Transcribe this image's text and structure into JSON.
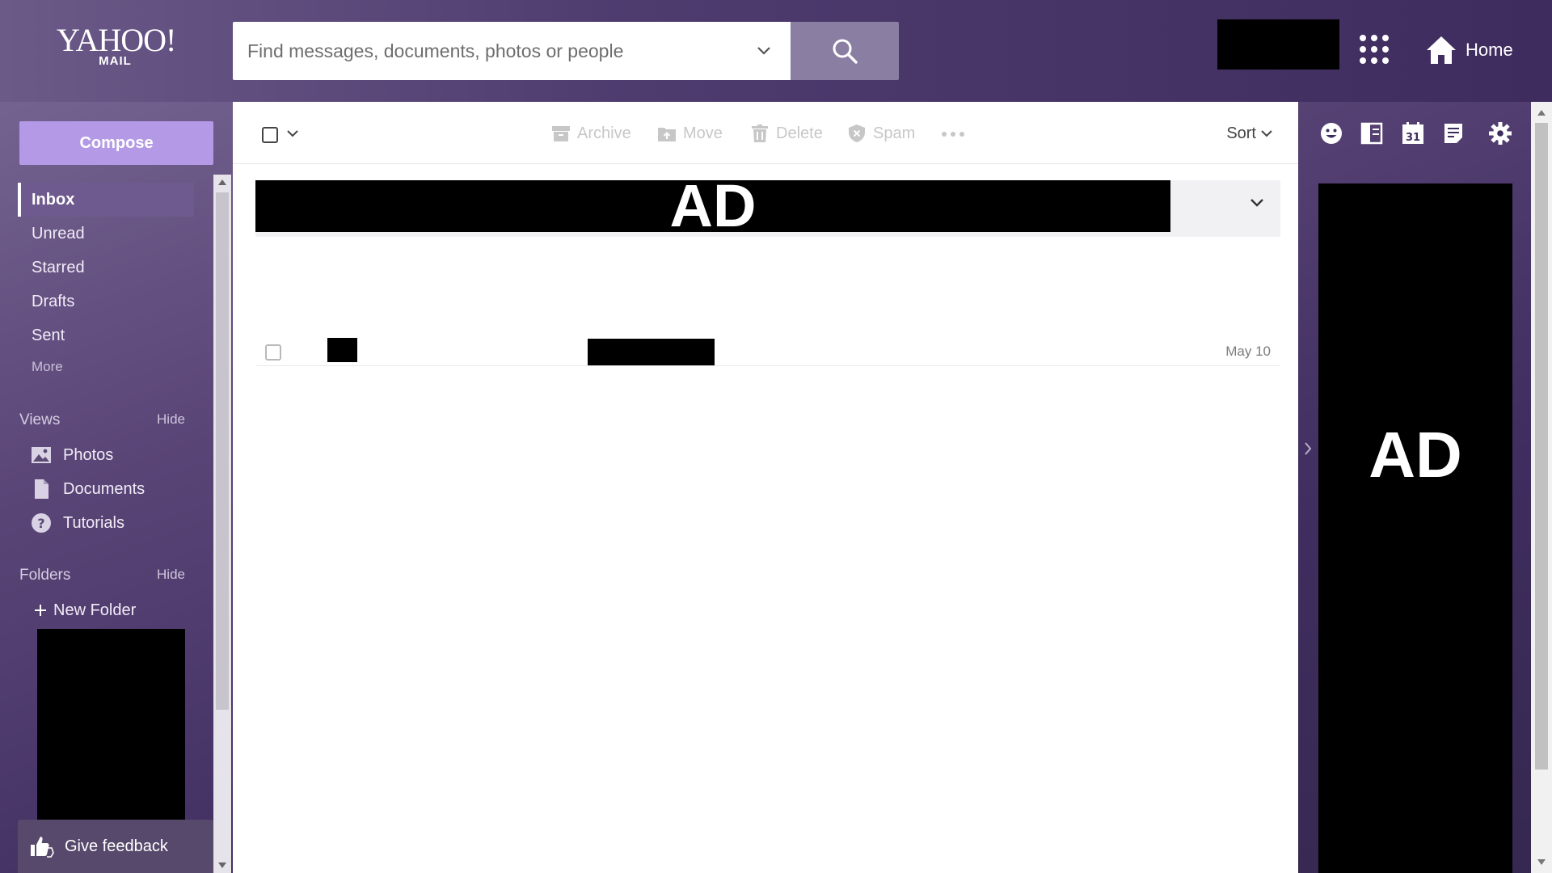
{
  "header": {
    "logo_top": "YAHOO!",
    "logo_bottom": "MAIL",
    "search_placeholder": "Find messages, documents, photos or people",
    "home_label": "Home"
  },
  "nav": {
    "compose_label": "Compose",
    "folders": [
      {
        "label": "Inbox",
        "active": true
      },
      {
        "label": "Unread"
      },
      {
        "label": "Starred"
      },
      {
        "label": "Drafts"
      },
      {
        "label": "Sent"
      }
    ],
    "more_label": "More",
    "views": {
      "title": "Views",
      "hide_label": "Hide",
      "items": [
        {
          "label": "Photos",
          "icon": "photo-icon"
        },
        {
          "label": "Documents",
          "icon": "document-icon"
        },
        {
          "label": "Tutorials",
          "icon": "help-icon"
        }
      ]
    },
    "folders_section": {
      "title": "Folders",
      "hide_label": "Hide",
      "new_folder_label": "New Folder"
    },
    "feedback_label": "Give feedback"
  },
  "toolbar": {
    "archive": "Archive",
    "move": "Move",
    "delete": "Delete",
    "spam": "Spam",
    "sort": "Sort"
  },
  "messages": {
    "ad_label": "AD",
    "rows": [
      {
        "date": "May 10"
      }
    ]
  },
  "right_rail": {
    "ad_label": "AD",
    "icons": [
      "emoji-icon",
      "layout-icon",
      "calendar-icon",
      "notepad-icon",
      "settings-icon"
    ],
    "calendar_day": "31"
  },
  "colors": {
    "header_gradient_start": "#6b5a88",
    "header_gradient_end": "#3e2c5e",
    "compose_button": "#b49ae6",
    "active_nav": "#6e5a8e",
    "search_button": "#8a7fa3"
  }
}
